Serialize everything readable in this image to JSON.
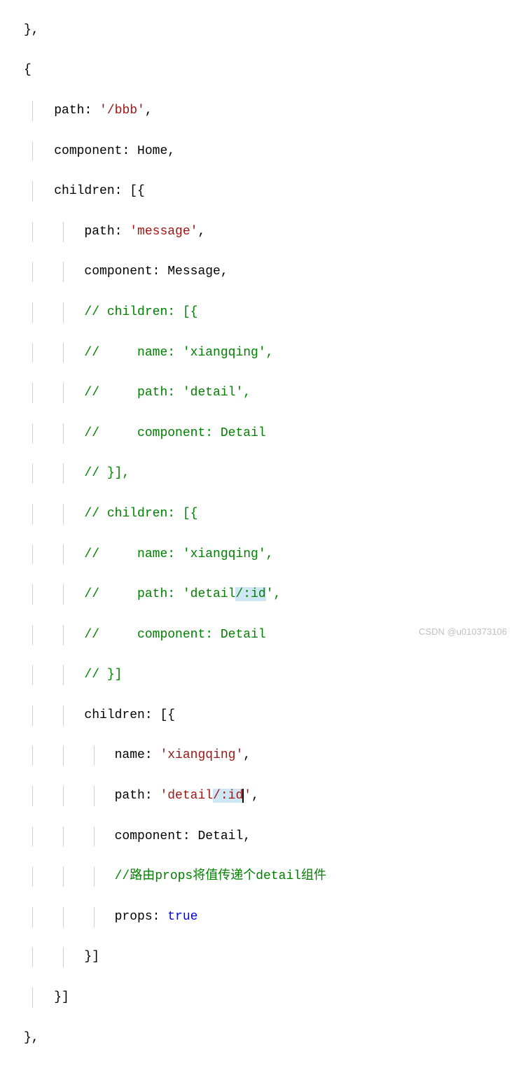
{
  "code": {
    "l1": {
      "punct": "},"
    },
    "l2": {
      "punct": "{"
    },
    "l3": {
      "prop": "path",
      "colon": ": ",
      "string": "'/bbb'",
      "comma": ","
    },
    "l4": {
      "prop": "component",
      "colon": ": ",
      "value": "Home",
      "comma": ","
    },
    "l5": {
      "prop": "children",
      "colon": ": ",
      "bracket": "[{"
    },
    "l6": {
      "prop": "path",
      "colon": ": ",
      "string": "'message'",
      "comma": ","
    },
    "l7": {
      "prop": "component",
      "colon": ": ",
      "value": "Message",
      "comma": ","
    },
    "l8": {
      "comment": "// children: [{"
    },
    "l9": {
      "comment": "//     name: 'xiangqing',"
    },
    "l10": {
      "comment": "//     path: 'detail',"
    },
    "l11": {
      "comment": "//     component: Detail"
    },
    "l12": {
      "comment": "// }],"
    },
    "l13": {
      "comment": "// children: [{"
    },
    "l14": {
      "comment": "//     name: 'xiangqing',"
    },
    "l15_pre": {
      "comment": "//     path: 'detail"
    },
    "l15_hl": {
      "comment": "/:id"
    },
    "l15_post": {
      "comment": "',"
    },
    "l16": {
      "comment": "//     component: Detail"
    },
    "l17": {
      "comment": "// }]"
    },
    "l18": {
      "prop": "children",
      "colon": ": ",
      "bracket": "[{"
    },
    "l19": {
      "prop": "name",
      "colon": ": ",
      "string": "'xiangqing'",
      "comma": ","
    },
    "l20_prop": {
      "prop": "path",
      "colon": ": "
    },
    "l20_str1": {
      "string": "'detail"
    },
    "l20_hl": {
      "string": "/:id"
    },
    "l20_str2": {
      "string": "'"
    },
    "l20_comma": {
      "comma": ","
    },
    "l21": {
      "prop": "component",
      "colon": ": ",
      "value": "Detail",
      "comma": ","
    },
    "l22": {
      "comment": "//路由props将值传递个detail组件"
    },
    "l23": {
      "prop": "props",
      "colon": ": ",
      "keyword": "true"
    },
    "l24": {
      "bracket": "}]"
    },
    "l25": {
      "bracket": "}]"
    },
    "l26": {
      "punct": "},"
    }
  },
  "watermark": "CSDN @u010373106"
}
